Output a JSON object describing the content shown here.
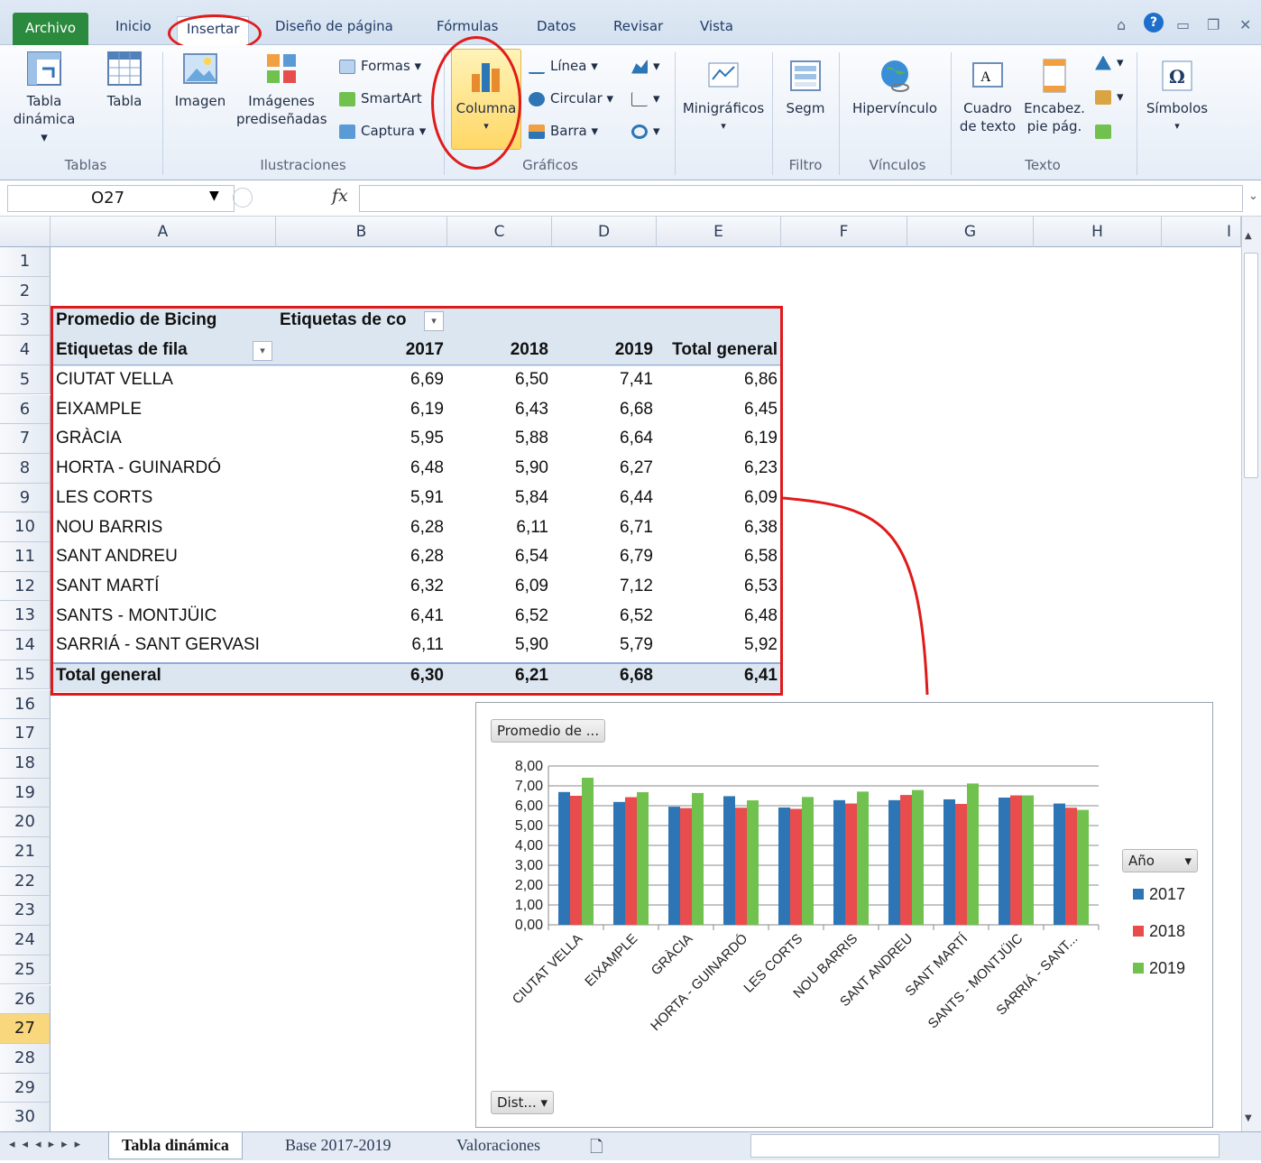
{
  "ribbon_tabs": {
    "file": "Archivo",
    "home": "Inicio",
    "insert": "Insertar",
    "layout": "Diseño de página",
    "formulas": "Fórmulas",
    "data": "Datos",
    "review": "Revisar",
    "view": "Vista"
  },
  "ribbon": {
    "pivot_table": [
      "Tabla",
      "dinámica ▾"
    ],
    "table": "Tabla",
    "image": "Imagen",
    "clipart": [
      "Imágenes",
      "prediseñadas"
    ],
    "shapes": "Formas ▾",
    "smartart": "SmartArt",
    "capture": "Captura ▾",
    "column": "Columna",
    "line": "Línea ▾",
    "pie": "Circular ▾",
    "bar": "Barra ▾",
    "sparklines": "Minigráficos",
    "slicer": "Segm",
    "hyperlink": "Hipervínculo",
    "textbox": [
      "Cuadro",
      "de texto"
    ],
    "header": [
      "Encabez.",
      "pie pág."
    ],
    "symbols": "Símbolos",
    "groups": {
      "tables": "Tablas",
      "illustrations": "Ilustraciones",
      "charts": "Gráficos",
      "filter": "Filtro",
      "links": "Vínculos",
      "text": "Texto"
    }
  },
  "formula_bar": {
    "name_box": "O27",
    "fx": "fx",
    "value": ""
  },
  "columns": [
    "A",
    "B",
    "C",
    "D",
    "E",
    "F",
    "G",
    "H",
    "I"
  ],
  "rows": [
    "1",
    "2",
    "3",
    "4",
    "5",
    "6",
    "7",
    "8",
    "9",
    "10",
    "11",
    "12",
    "13",
    "14",
    "15",
    "16",
    "17",
    "18",
    "19",
    "20",
    "21",
    "22",
    "23",
    "24",
    "25",
    "26",
    "27",
    "28",
    "29",
    "30"
  ],
  "selected_row": "27",
  "pivot": {
    "value_label": "Promedio de Bicing",
    "col_labels": "Etiquetas de co",
    "row_labels": "Etiquetas de fila",
    "headers": [
      "2017",
      "2018",
      "2019",
      "Total general"
    ],
    "rows": [
      {
        "name": "CIUTAT VELLA",
        "v": [
          "6,69",
          "6,50",
          "7,41",
          "6,86"
        ]
      },
      {
        "name": "EIXAMPLE",
        "v": [
          "6,19",
          "6,43",
          "6,68",
          "6,45"
        ]
      },
      {
        "name": "GRÀCIA",
        "v": [
          "5,95",
          "5,88",
          "6,64",
          "6,19"
        ]
      },
      {
        "name": "HORTA - GUINARDÓ",
        "v": [
          "6,48",
          "5,90",
          "6,27",
          "6,23"
        ]
      },
      {
        "name": "LES CORTS",
        "v": [
          "5,91",
          "5,84",
          "6,44",
          "6,09"
        ]
      },
      {
        "name": "NOU BARRIS",
        "v": [
          "6,28",
          "6,11",
          "6,71",
          "6,38"
        ]
      },
      {
        "name": "SANT ANDREU",
        "v": [
          "6,28",
          "6,54",
          "6,79",
          "6,58"
        ]
      },
      {
        "name": "SANT MARTÍ",
        "v": [
          "6,32",
          "6,09",
          "7,12",
          "6,53"
        ]
      },
      {
        "name": "SANTS - MONTJÜIC",
        "v": [
          "6,41",
          "6,52",
          "6,52",
          "6,48"
        ]
      },
      {
        "name": "SARRIÁ - SANT GERVASI",
        "v": [
          "6,11",
          "5,90",
          "5,79",
          "5,92"
        ]
      }
    ],
    "total": {
      "name": "Total general",
      "v": [
        "6,30",
        "6,21",
        "6,68",
        "6,41"
      ]
    }
  },
  "chart_data": {
    "type": "bar",
    "title": "",
    "value_button": "Promedio de ...",
    "axis_button": "Dist...",
    "legend_title": "Año",
    "legend_position": "right",
    "categories": [
      "CIUTAT VELLA",
      "EIXAMPLE",
      "GRÀCIA",
      "HORTA - GUINARDÓ",
      "LES CORTS",
      "NOU BARRIS",
      "SANT ANDREU",
      "SANT MARTÍ",
      "SANTS - MONTJÜIC",
      "SARRIÁ - SANT..."
    ],
    "yticks": [
      "0,00",
      "1,00",
      "2,00",
      "3,00",
      "4,00",
      "5,00",
      "6,00",
      "7,00",
      "8,00"
    ],
    "ylim": [
      0,
      8
    ],
    "grid": true,
    "series": [
      {
        "name": "2017",
        "color": "#2e75b6",
        "values": [
          6.69,
          6.19,
          5.95,
          6.48,
          5.91,
          6.28,
          6.28,
          6.32,
          6.41,
          6.11
        ]
      },
      {
        "name": "2018",
        "color": "#e84c4c",
        "values": [
          6.5,
          6.43,
          5.88,
          5.9,
          5.84,
          6.11,
          6.54,
          6.09,
          6.52,
          5.9
        ]
      },
      {
        "name": "2019",
        "color": "#70c14e",
        "values": [
          7.41,
          6.68,
          6.64,
          6.27,
          6.44,
          6.71,
          6.79,
          7.12,
          6.52,
          5.79
        ]
      }
    ]
  },
  "sheets": [
    "Tabla dinámica",
    "Base 2017-2019",
    "Valoraciones"
  ],
  "active_sheet": "Tabla dinámica",
  "colors": {
    "annotation_red": "#e01a1a",
    "pivot_band": "#dce6f1",
    "file_tab": "#2b8a3e",
    "selection": "#f9d77c"
  }
}
